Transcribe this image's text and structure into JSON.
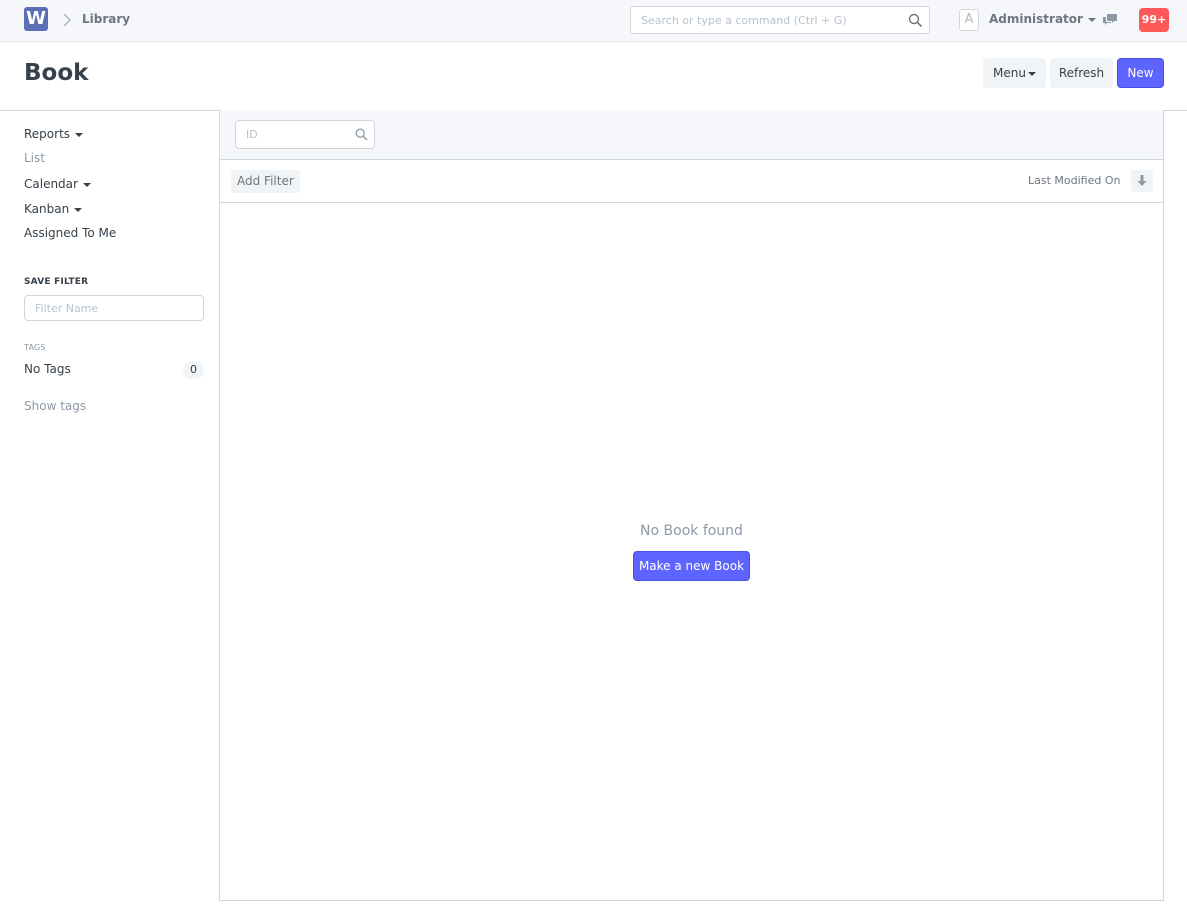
{
  "navbar": {
    "logo_letter": "W",
    "breadcrumb": "Library",
    "search_placeholder": "Search or type a command (Ctrl + G)",
    "avatar_letter": "A",
    "user_name": "Administrator",
    "notification_count": "99+"
  },
  "page": {
    "title": "Book",
    "menu_label": "Menu",
    "refresh_label": "Refresh",
    "new_label": "New"
  },
  "sidebar": {
    "reports": "Reports",
    "list": "List",
    "calendar": "Calendar",
    "kanban": "Kanban",
    "assigned_to_me": "Assigned To Me",
    "save_filter_heading": "SAVE FILTER",
    "filter_name_placeholder": "Filter Name",
    "tags_heading": "TAGS",
    "no_tags": "No Tags",
    "no_tags_count": "0",
    "show_tags": "Show tags"
  },
  "list": {
    "id_placeholder": "ID",
    "add_filter": "Add Filter",
    "sort_label": "Last Modified On",
    "empty_message": "No Book found",
    "make_new": "Make a new Book"
  },
  "colors": {
    "primary": "#5e64ff",
    "notification": "#ff5858",
    "logo": "#5b6fb5"
  }
}
